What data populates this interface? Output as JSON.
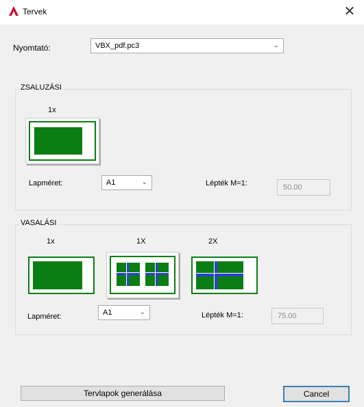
{
  "window": {
    "title": "Tervek",
    "close_icon": "close-icon",
    "app_icon": "autocad-logo-icon",
    "accent": "#c8102e"
  },
  "printer": {
    "label": "Nyomtató:",
    "value": "VBX_pdf.pc3"
  },
  "zsaluzasi": {
    "title": "ZSALUZÁSI",
    "layouts": [
      {
        "label": "1x",
        "selected": true
      }
    ],
    "paper_size_label": "Lapméret:",
    "paper_size_value": "A1",
    "scale_label": "Lépték M=1:",
    "scale_value": "50.00"
  },
  "vasalasi": {
    "title": "VASALÁSI",
    "layouts": [
      {
        "label": "1x",
        "selected": false
      },
      {
        "label": "1X",
        "selected": true
      },
      {
        "label": "2X",
        "selected": false
      }
    ],
    "paper_size_label": "Lapméret:",
    "paper_size_value": "A1",
    "scale_label": "Lépték M=1:",
    "scale_value": "75.00"
  },
  "buttons": {
    "generate": "Tervlapok generálása",
    "cancel": "Cancel"
  },
  "colors": {
    "sheet_green": "#0a7d13",
    "rebar_blue": "#2b3fd6",
    "focus_blue": "#3c7fb1"
  }
}
